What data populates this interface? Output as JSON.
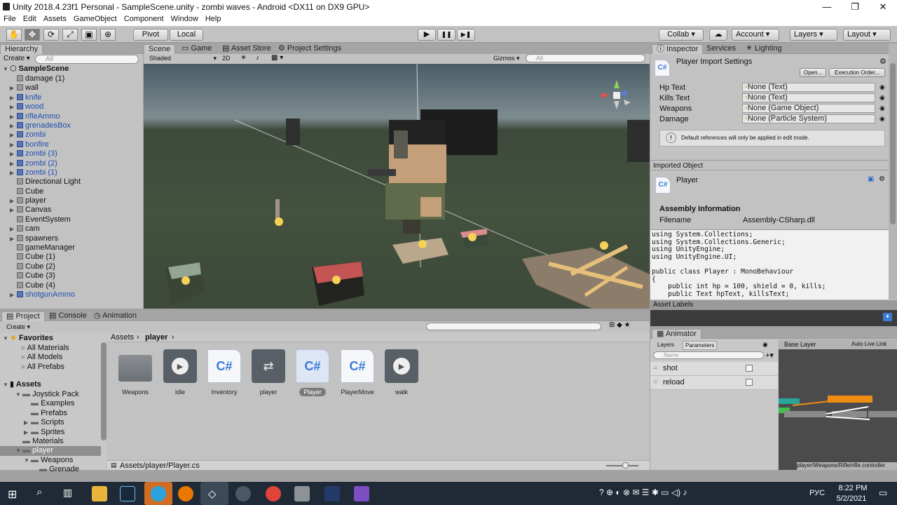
{
  "window": {
    "title": "Unity 2018.4.23f1 Personal - SampleScene.unity - zombi waves - Android <DX11 on DX9 GPU>",
    "min": "—",
    "max": "❐",
    "close": "✕"
  },
  "menu": [
    "File",
    "Edit",
    "Assets",
    "GameObject",
    "Component",
    "Window",
    "Help"
  ],
  "toolbar": {
    "pivot": "Pivot",
    "local": "Local",
    "collab": "Collab ▾",
    "account": "Account",
    "layers": "Layers",
    "layout": "Layout",
    "play": "▶",
    "pause": "❚❚",
    "step": "▶❚"
  },
  "hierarchy": {
    "tab": "Hierarchy",
    "create": "Create ▾",
    "search": "All",
    "scene": "SampleScene",
    "items": [
      {
        "label": "damage (1)",
        "blue": false,
        "arrow": false
      },
      {
        "label": "wall",
        "blue": false,
        "arrow": true
      },
      {
        "label": "knife",
        "blue": true,
        "arrow": true
      },
      {
        "label": "wood",
        "blue": true,
        "arrow": true
      },
      {
        "label": "rifleAmmo",
        "blue": true,
        "arrow": true
      },
      {
        "label": "grenadesBox",
        "blue": true,
        "arrow": true
      },
      {
        "label": "zombi",
        "blue": true,
        "arrow": true
      },
      {
        "label": "bonfire",
        "blue": true,
        "arrow": true
      },
      {
        "label": "zombi (3)",
        "blue": true,
        "arrow": true
      },
      {
        "label": "zombi (2)",
        "blue": true,
        "arrow": true
      },
      {
        "label": "zombi (1)",
        "blue": true,
        "arrow": true
      },
      {
        "label": "Directional Light",
        "blue": false,
        "arrow": false
      },
      {
        "label": "Cube",
        "blue": false,
        "arrow": false
      },
      {
        "label": "player",
        "blue": false,
        "arrow": true
      },
      {
        "label": "Canvas",
        "blue": false,
        "arrow": true
      },
      {
        "label": "EventSystem",
        "blue": false,
        "arrow": false
      },
      {
        "label": "cam",
        "blue": false,
        "arrow": true
      },
      {
        "label": "spawners",
        "blue": false,
        "arrow": true
      },
      {
        "label": "gameManager",
        "blue": false,
        "arrow": false
      },
      {
        "label": "Cube (1)",
        "blue": false,
        "arrow": false
      },
      {
        "label": "Cube (2)",
        "blue": false,
        "arrow": false
      },
      {
        "label": "Cube (3)",
        "blue": false,
        "arrow": false
      },
      {
        "label": "Cube (4)",
        "blue": false,
        "arrow": false
      },
      {
        "label": "shotgunAmmo",
        "blue": true,
        "arrow": true
      }
    ]
  },
  "scene_tabs": {
    "scene": "Scene",
    "game": "Game",
    "asset_store": "Asset Store",
    "project_settings": "Project Settings",
    "shaded": "Shaded",
    "mode2d": "2D",
    "gizmos": "Gizmos ▾",
    "search": "All"
  },
  "inspector": {
    "tabs": [
      "Inspector",
      "Services",
      "Lighting"
    ],
    "title": "Player Import Settings",
    "open": "Open...",
    "exec": "Execution Order...",
    "fields": [
      {
        "label": "Hp Text",
        "value": "None (Text)"
      },
      {
        "label": "Kills Text",
        "value": "None (Text)"
      },
      {
        "label": "Weapons",
        "value": "None (Game Object)"
      },
      {
        "label": "Damage",
        "value": "None (Particle System)"
      }
    ],
    "note": "Default references will only be applied in edit mode.",
    "imported": "Imported Object",
    "obj": "Player",
    "asm_head": "Assembly Information",
    "filename_label": "Filename",
    "filename": "Assembly-CSharp.dll",
    "code": "using System.Collections;\nusing System.Collections.Generic;\nusing UnityEngine;\nusing UnityEngine.UI;\n\npublic class Player : MonoBehaviour\n{\n    public int hp = 100, shield = 0, kills;\n    public Text hpText, killsText;",
    "asset_labels": "Asset Labels"
  },
  "animator": {
    "tab": "Animator",
    "layers": "Layers",
    "parameters": "Parameters",
    "search": "Name",
    "params": [
      {
        "name": "shot"
      },
      {
        "name": "reload"
      }
    ],
    "base_layer": "Base Layer",
    "auto_live": "Auto Live Link",
    "path": "player/Weapons/Rifle/rifle.controller"
  },
  "project": {
    "tabs": [
      "Project",
      "Console",
      "Animation"
    ],
    "create": "Create ▾",
    "breadcrumb": [
      "Assets",
      "player"
    ],
    "favorites": "Favorites",
    "fav_items": [
      "All Materials",
      "All Models",
      "All Prefabs"
    ],
    "assets_label": "Assets",
    "tree": [
      {
        "label": "Joystick Pack",
        "lvl": 1
      },
      {
        "label": "Examples",
        "lvl": 2
      },
      {
        "label": "Prefabs",
        "lvl": 2
      },
      {
        "label": "Scripts",
        "lvl": 2
      },
      {
        "label": "Sprites",
        "lvl": 2
      },
      {
        "label": "Materials",
        "lvl": 1
      },
      {
        "label": "player",
        "lvl": 1
      },
      {
        "label": "Weapons",
        "lvl": 2
      },
      {
        "label": "Grenade",
        "lvl": 3
      }
    ],
    "assets": [
      {
        "name": "Weapons",
        "kind": "folder"
      },
      {
        "name": "idle",
        "kind": "anim"
      },
      {
        "name": "Inventory",
        "kind": "script"
      },
      {
        "name": "player",
        "kind": "controller"
      },
      {
        "name": "Player",
        "kind": "script"
      },
      {
        "name": "PlayerMove",
        "kind": "script"
      },
      {
        "name": "walk",
        "kind": "anim"
      }
    ],
    "path": "Assets/player/Player.cs"
  },
  "taskbar": {
    "time": "8:22 PM",
    "date": "5/2/2021",
    "lang": "РУС"
  }
}
